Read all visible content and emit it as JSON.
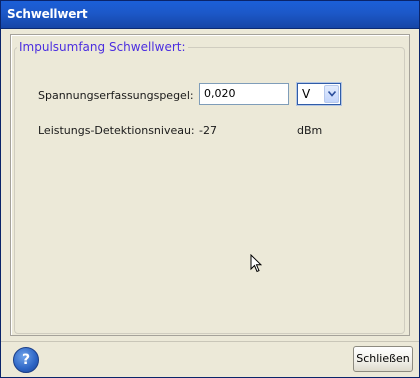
{
  "window": {
    "title": "Schwellwert"
  },
  "group": {
    "legend": "Impulsumfang Schwellwert:"
  },
  "fields": {
    "voltage": {
      "label": "Spannungserfassungspegel:",
      "value": "0,020",
      "unit": "V"
    },
    "power": {
      "label": "Leistungs-Detektionsniveau:",
      "value": "-27",
      "unit": "dBm"
    }
  },
  "footer": {
    "help_icon": "question-mark-icon",
    "help_glyph": "?",
    "close_label": "Schließen"
  },
  "colors": {
    "titlebar": "#1c58c8",
    "legend_text": "#4b2ee0",
    "dialog_bg": "#ece9d8"
  }
}
